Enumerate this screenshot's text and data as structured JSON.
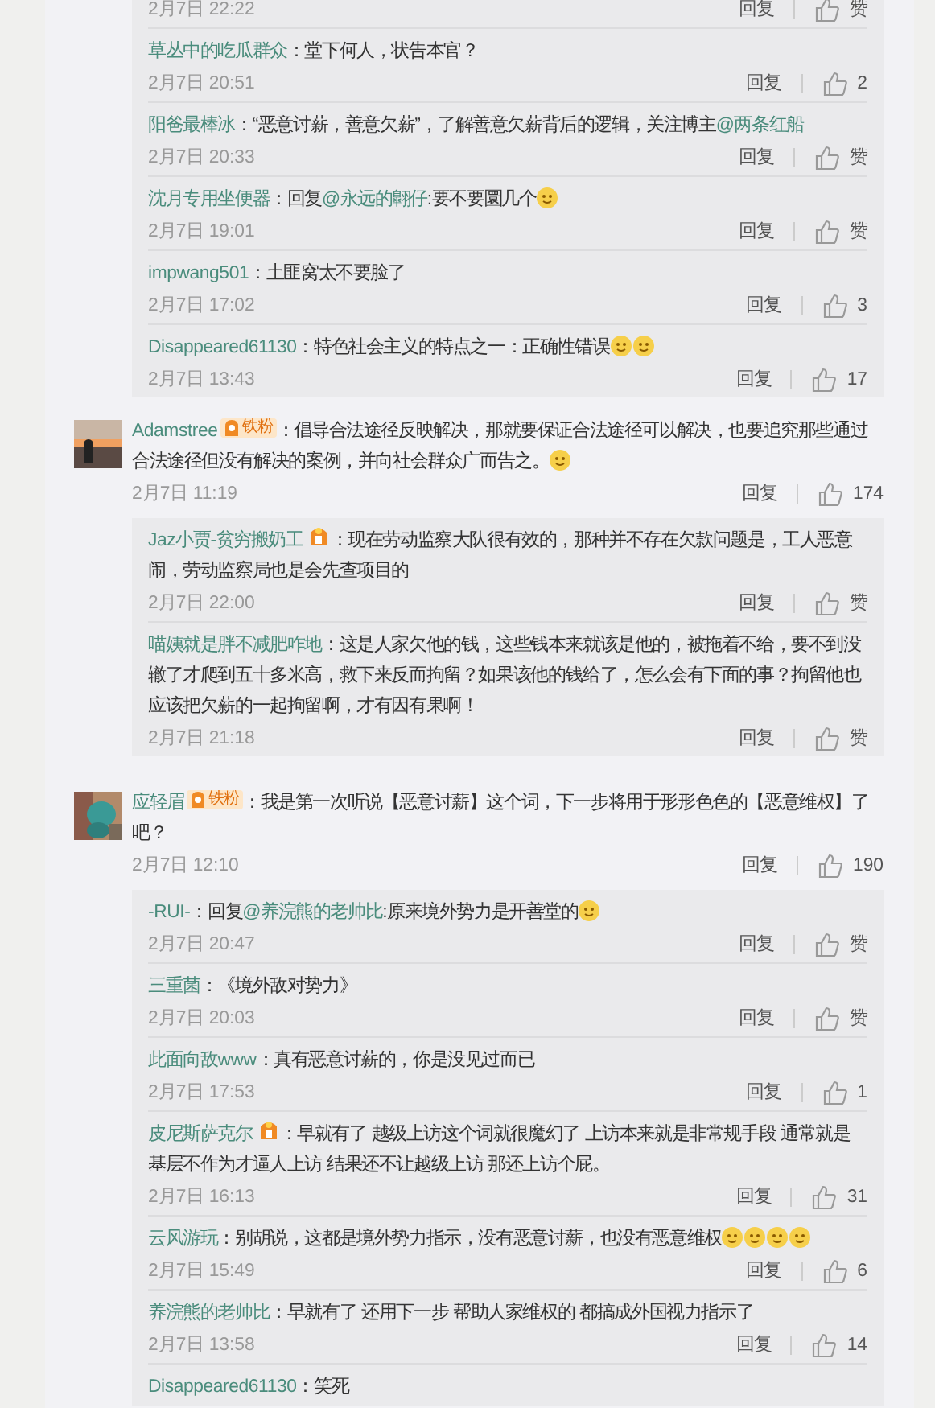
{
  "leading_replies": [
    {
      "time": "2月7日 22:22",
      "reply_label": "回复",
      "likes": "赞"
    },
    {
      "author": "草丛中的吃瓜群众",
      "content": [
        {
          "kind": "text",
          "text": "：堂下何人，状告本官？"
        }
      ],
      "time": "2月7日 20:51",
      "reply_label": "回复",
      "likes": "2"
    },
    {
      "author": "阳爸最棒冰",
      "content": [
        {
          "kind": "text",
          "text": "：“恶意讨薪，善意欠薪”，了解善意欠薪背后的逻辑，关注博主"
        },
        {
          "kind": "mention",
          "text": "@两条红船"
        }
      ],
      "time": "2月7日 20:33",
      "reply_label": "回复",
      "likes": "赞"
    },
    {
      "author": "沈月专用坐便器",
      "content": [
        {
          "kind": "text",
          "text": "：回复"
        },
        {
          "kind": "mention",
          "text": "@永远的翺仔"
        },
        {
          "kind": "text",
          "text": ":要不要圜几个"
        },
        {
          "kind": "emoji"
        }
      ],
      "time": "2月7日 19:01",
      "reply_label": "回复",
      "likes": "赞"
    },
    {
      "author": "impwang501",
      "content": [
        {
          "kind": "text",
          "text": "：土匪窝太不要脸了"
        }
      ],
      "time": "2月7日 17:02",
      "reply_label": "回复",
      "likes": "3"
    },
    {
      "author": "Disappeared61130",
      "content": [
        {
          "kind": "text",
          "text": "：特色社会主义的特点之一：正确性错误"
        },
        {
          "kind": "emoji"
        },
        {
          "kind": "emoji"
        }
      ],
      "time": "2月7日 13:43",
      "reply_label": "回复",
      "likes": "17"
    }
  ],
  "comments": [
    {
      "author": "Adamstree",
      "avatar": {
        "kind": "picture"
      },
      "badge": {
        "kind": "fan",
        "label": "铁粉"
      },
      "content": [
        {
          "kind": "text",
          "text": "：倡导合法途径反映解决，那就要保证合法途径可以解决，也要追究那些通过合法途径但没有解决的案例，并向社会群众广而告之。"
        },
        {
          "kind": "emoji"
        }
      ],
      "time": "2月7日 11:19",
      "reply_label": "回复",
      "likes": "174",
      "replies": [
        {
          "author": "Jaz小贾-贫穷搬奶工",
          "badge": {
            "kind": "vip"
          },
          "content": [
            {
              "kind": "text",
              "text": "：现在劳动监察大队很有效的，那种并不存在欠款问题是，工人恶意闹，劳动监察局也是会先查项目的"
            }
          ],
          "time": "2月7日 22:00",
          "reply_label": "回复",
          "likes": "赞"
        },
        {
          "author": "喵姨就是胖不减肥咋地",
          "content": [
            {
              "kind": "text",
              "text": "：这是人家欠他的钱，这些钱本来就该是他的，被拖着不给，要不到没辙了才爬到五十多米高，救下来反而拘留？如果该他的钱给了，怎么会有下面的事？拘留他也应该把欠薪的一起拘留啊，才有因有果啊！"
            }
          ],
          "time": "2月7日 21:18",
          "reply_label": "回复",
          "likes": "赞"
        }
      ]
    },
    {
      "author": "应轻眉",
      "avatar": {
        "kind": "picture"
      },
      "badge": {
        "kind": "fan",
        "label": "铁粉"
      },
      "content": [
        {
          "kind": "text",
          "text": "：我是第一次听说【恶意讨薪】这个词，下一步将用于形形色色的【恶意维权】了吧？"
        }
      ],
      "time": "2月7日 12:10",
      "reply_label": "回复",
      "likes": "190",
      "replies": [
        {
          "author": "-RUI-",
          "content": [
            {
              "kind": "text",
              "text": "：回复"
            },
            {
              "kind": "mention",
              "text": "@养浣熊的老帅比"
            },
            {
              "kind": "text",
              "text": ":原来境外势力是开善堂的"
            },
            {
              "kind": "emoji"
            }
          ],
          "time": "2月7日 20:47",
          "reply_label": "回复",
          "likes": "赞"
        },
        {
          "author": "三重菌",
          "content": [
            {
              "kind": "text",
              "text": "：《境外敌对势力》"
            }
          ],
          "time": "2月7日 20:03",
          "reply_label": "回复",
          "likes": "赞"
        },
        {
          "author": "此面向敌www",
          "content": [
            {
              "kind": "text",
              "text": "：真有恶意讨薪的，你是没见过而已"
            }
          ],
          "time": "2月7日 17:53",
          "reply_label": "回复",
          "likes": "1"
        },
        {
          "author": "皮尼斯萨克尔",
          "badge": {
            "kind": "vip"
          },
          "content": [
            {
              "kind": "text",
              "text": "：早就有了 越级上访这个词就很魔幻了 上访本来就是非常规手段 通常就是基层不作为才逼人上访 结果还不让越级上访 那还上访个屁。"
            }
          ],
          "time": "2月7日 16:13",
          "reply_label": "回复",
          "likes": "31"
        },
        {
          "author": "云风游玩",
          "content": [
            {
              "kind": "text",
              "text": "：别胡说，这都是境外势力指示，没有恶意讨薪，也没有恶意维权"
            },
            {
              "kind": "emoji"
            },
            {
              "kind": "emoji"
            },
            {
              "kind": "emoji"
            },
            {
              "kind": "emoji"
            }
          ],
          "time": "2月7日 15:49",
          "reply_label": "回复",
          "likes": "6"
        },
        {
          "author": "养浣熊的老帅比",
          "content": [
            {
              "kind": "text",
              "text": "：早就有了 还用下一步 帮助人家维权的 都搞成外国视力指示了"
            }
          ],
          "time": "2月7日 13:58",
          "reply_label": "回复",
          "likes": "14"
        },
        {
          "author": "Disappeared61130",
          "content": [
            {
              "kind": "text",
              "text": "：笑死"
            }
          ]
        }
      ]
    }
  ]
}
